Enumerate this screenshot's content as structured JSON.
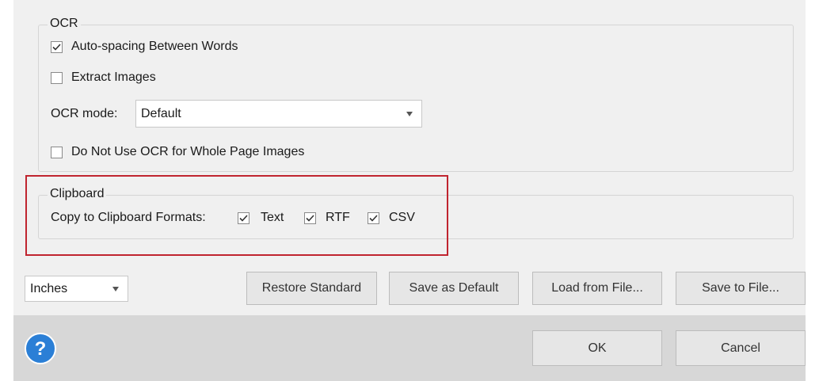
{
  "ocr": {
    "legend": "OCR",
    "auto_spacing": {
      "label": "Auto-spacing Between Words",
      "checked": true
    },
    "extract_images": {
      "label": "Extract Images",
      "checked": false
    },
    "mode": {
      "label": "OCR mode:",
      "value": "Default"
    },
    "no_ocr_whole_page": {
      "label": "Do Not Use OCR for Whole Page Images",
      "checked": false
    }
  },
  "clipboard": {
    "legend": "Clipboard",
    "formats_label": "Copy to Clipboard Formats:",
    "formats": [
      {
        "label": "Text",
        "checked": true
      },
      {
        "label": "RTF",
        "checked": true
      },
      {
        "label": "CSV",
        "checked": true
      }
    ],
    "highlight_color": "#c0242f"
  },
  "toolbar": {
    "units": "Inches",
    "restore_standard": "Restore Standard",
    "save_as_default": "Save as Default",
    "load_from_file": "Load from File...",
    "save_to_file": "Save to File..."
  },
  "footer": {
    "help_icon": "question-mark-icon",
    "ok": "OK",
    "cancel": "Cancel"
  },
  "colors": {
    "help_blue": "#2b7fd6",
    "panel_bg": "#f0f0f0",
    "footer_bg": "#d7d7d7"
  }
}
